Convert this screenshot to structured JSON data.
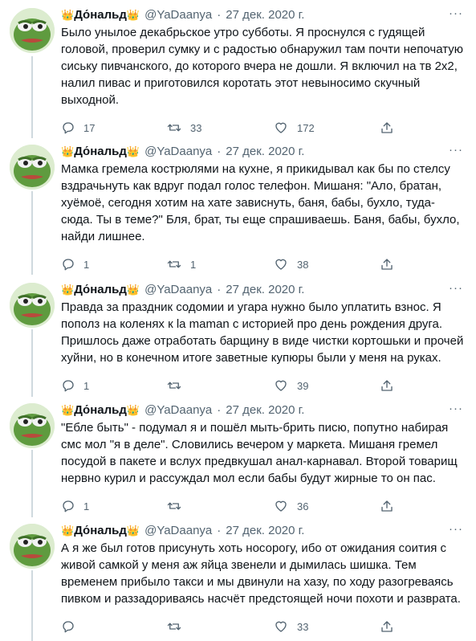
{
  "colors": {
    "meta": "#536471",
    "rail": "#cfd9de",
    "text": "#0f1419",
    "crown": "#e8b20f"
  },
  "author": {
    "crown": "👑",
    "name": "До́нальд",
    "handle": "@YaDaanya",
    "more": "···"
  },
  "tweets": [
    {
      "date": "27 дек. 2020 г.",
      "text": "Было унылое декабрьское утро субботы. Я проснулся с гудящей головой, проверил сумку и с радостью обнаружил там почти непочатую сиську пивчанского, до которого вчера не дошли. Я включил на тв 2х2, налил пивас и приготовился  коротать этот невыносимо скучный выходной.",
      "replies": "17",
      "retweets": "33",
      "likes": "172"
    },
    {
      "date": "27 дек. 2020 г.",
      "text": "Мамка гремела кострюлями на кухне, я прикидывал как бы по стелсу вздрачьнуть как вдруг подал голос телефон. Мишаня: \"Ало, братан, хуёмоё, сегодня хотим на хате зависнуть, баня, бабы, бухло, туда-сюда. Ты в теме?\" Бля, брат, ты еще спрашиваешь. Баня, бабы, бухло, найди лишнее.",
      "replies": "1",
      "retweets": "1",
      "likes": "38"
    },
    {
      "date": "27 дек. 2020 г.",
      "text": "Правда за праздник содомии и угара нужно было уплатить взнос. Я пополз на коленях к la maman с историей про день рождения друга. Пришлось даже отработать барщину в виде чистки кортошьки и прочей хуйни, но в конечном итоге заветные купюры были у меня на руках.",
      "replies": "1",
      "retweets": "",
      "likes": "39"
    },
    {
      "date": "27 дек. 2020 г.",
      "text": "\"Ебле быть\" - подумал я и пошёл мыть-брить писю, попутно набирая смс мол \"я в деле\". Словились вечером у маркета. Мишаня гремел посудой в пакете и вслух предвкушал анал-карнавал. Второй товарищ нервно курил и рассуждал мол если бабы будут жирные то он пас.",
      "replies": "1",
      "retweets": "",
      "likes": "36"
    },
    {
      "date": "27 дек. 2020 г.",
      "text": "А я же был готов присунуть хоть носорогу, ибо от ожидания соития с живой самкой у меня аж яйца звенели и дымилась шишка. Тем временем прибыло такси и мы двинули на хазу, по ходу разогреваясь пивком и раззадориваясь насчёт предстоящей ночи похоти и разврата.",
      "replies": "",
      "retweets": "",
      "likes": "33"
    }
  ]
}
